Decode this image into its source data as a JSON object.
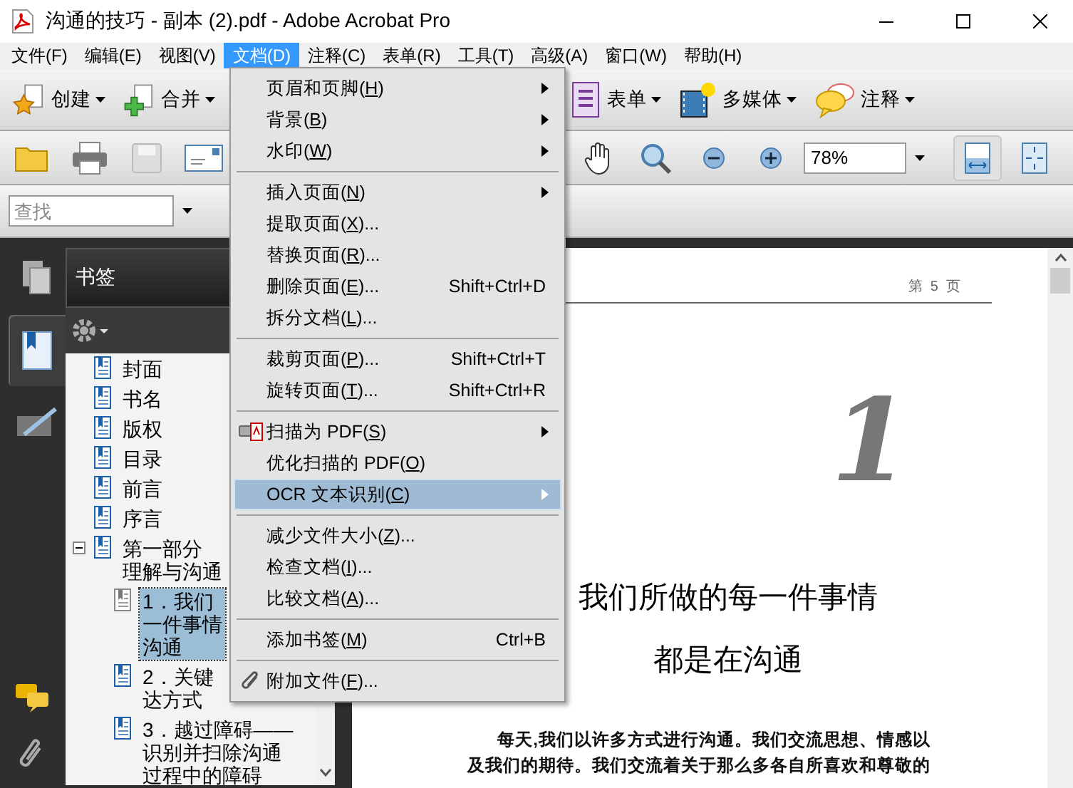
{
  "window": {
    "title": "沟通的技巧 - 副本 (2).pdf - Adobe Acrobat Pro"
  },
  "menu_bar": [
    {
      "label": "文件(F)",
      "selected": false
    },
    {
      "label": "编辑(E)",
      "selected": false
    },
    {
      "label": "视图(V)",
      "selected": false
    },
    {
      "label": "文档(D)",
      "selected": true
    },
    {
      "label": "注释(C)",
      "selected": false
    },
    {
      "label": "表单(R)",
      "selected": false
    },
    {
      "label": "工具(T)",
      "selected": false
    },
    {
      "label": "高级(A)",
      "selected": false
    },
    {
      "label": "窗口(W)",
      "selected": false
    },
    {
      "label": "帮助(H)",
      "selected": false
    }
  ],
  "task_toolbar": [
    {
      "label": "创建"
    },
    {
      "label": "合并"
    },
    {
      "label": "表单"
    },
    {
      "label": "多媒体"
    },
    {
      "label": "注释"
    }
  ],
  "zoom": {
    "value": "78%"
  },
  "fit_buttons": [
    {
      "selected": true
    },
    {
      "selected": false
    }
  ],
  "search": {
    "placeholder": "查找"
  },
  "nav_pane": [
    {
      "selected": false
    },
    {
      "selected": true
    },
    {
      "selected": false
    }
  ],
  "bookmarks_panel": {
    "title": "书签",
    "items": [
      {
        "lines": [
          "封面"
        ],
        "selected": false
      },
      {
        "lines": [
          "书名"
        ],
        "selected": false
      },
      {
        "lines": [
          "版权"
        ],
        "selected": false
      },
      {
        "lines": [
          "目录"
        ],
        "selected": false
      },
      {
        "lines": [
          "前言"
        ],
        "selected": false
      },
      {
        "lines": [
          "序言"
        ],
        "selected": false
      },
      {
        "lines": [
          "第一部分",
          "理解与沟通"
        ],
        "selected": false,
        "expanded": true,
        "children": [
          {
            "lines": [
              "1．我们",
              "一件事情",
              "沟通"
            ],
            "selected": true
          },
          {
            "lines": [
              "2．关键",
              "达方式"
            ],
            "selected": false
          },
          {
            "lines": [
              "3．越过障碍——",
              "识别并扫除沟通",
              "过程中的障碍"
            ],
            "selected": false
          }
        ]
      }
    ]
  },
  "document": {
    "header": "第  5  页",
    "chapter_number": "1",
    "title_lines": [
      "我们所做的每一件事情",
      "都是在沟通"
    ],
    "paragraph_lines": [
      "每天,我们以许多方式进行沟通。我们交流思想、情感以",
      "及我们的期待。我们交流着关于那么多各自所喜欢和尊敬的"
    ]
  },
  "dropdown_menu": {
    "items": [
      {
        "kind": "item",
        "label": "页眉和页脚(H)",
        "submenu": true,
        "selected": false
      },
      {
        "kind": "item",
        "label": "背景(B)",
        "submenu": true,
        "selected": false
      },
      {
        "kind": "item",
        "label": "水印(W)",
        "submenu": true,
        "selected": false
      },
      {
        "kind": "separator"
      },
      {
        "kind": "item",
        "label": "插入页面(N)",
        "submenu": true,
        "selected": false
      },
      {
        "kind": "item",
        "label": "提取页面(X)...",
        "selected": false
      },
      {
        "kind": "item",
        "label": "替换页面(R)...",
        "selected": false
      },
      {
        "kind": "item",
        "label": "删除页面(E)...",
        "shortcut": "Shift+Ctrl+D",
        "selected": false
      },
      {
        "kind": "item",
        "label": "拆分文档(L)...",
        "selected": false
      },
      {
        "kind": "separator"
      },
      {
        "kind": "item",
        "label": "裁剪页面(P)...",
        "shortcut": "Shift+Ctrl+T",
        "selected": false
      },
      {
        "kind": "item",
        "label": "旋转页面(T)...",
        "shortcut": "Shift+Ctrl+R",
        "selected": false
      },
      {
        "kind": "separator"
      },
      {
        "kind": "item",
        "label": "扫描为 PDF(S)",
        "submenu": true,
        "selected": false
      },
      {
        "kind": "item",
        "label": "优化扫描的 PDF(O)",
        "selected": false
      },
      {
        "kind": "item",
        "label": "OCR 文本识别(C)",
        "submenu": true,
        "selected": true
      },
      {
        "kind": "separator"
      },
      {
        "kind": "item",
        "label": "减少文件大小(Z)...",
        "selected": false
      },
      {
        "kind": "item",
        "label": "检查文档(I)...",
        "selected": false
      },
      {
        "kind": "item",
        "label": "比较文档(A)...",
        "selected": false
      },
      {
        "kind": "separator"
      },
      {
        "kind": "item",
        "label": "添加书签(M)",
        "shortcut": "Ctrl+B",
        "selected": false
      },
      {
        "kind": "separator"
      },
      {
        "kind": "item",
        "label": "附加文件(F)...",
        "selected": false
      }
    ]
  }
}
